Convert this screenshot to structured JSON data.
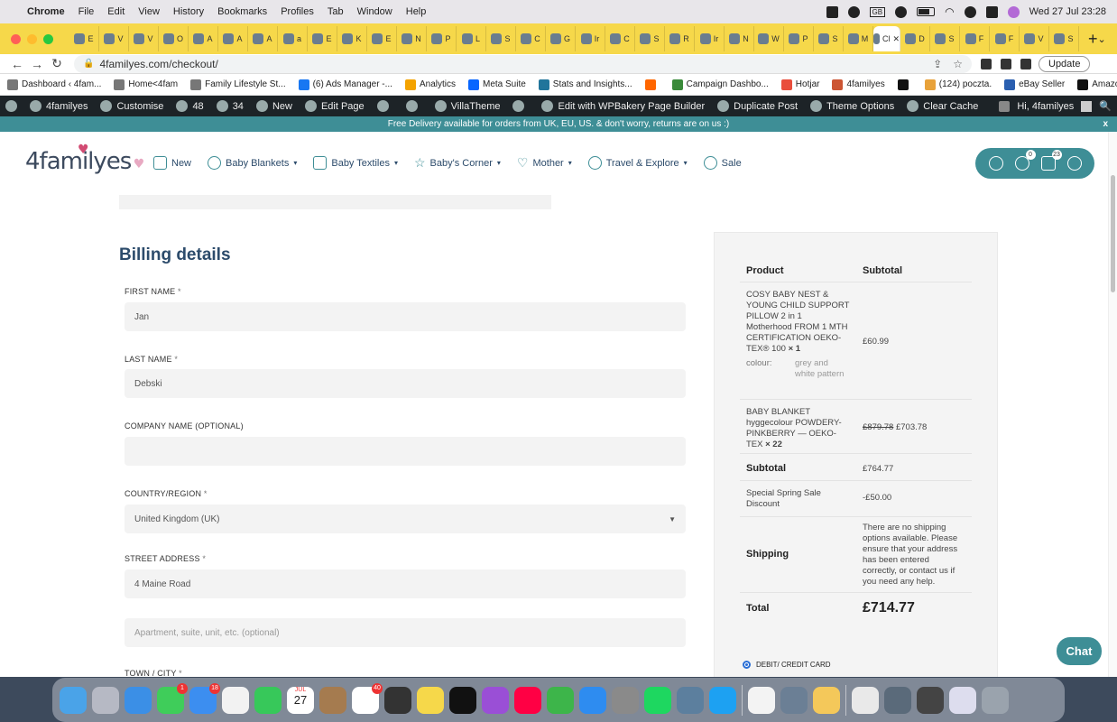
{
  "menubar": {
    "app": "Chrome",
    "items": [
      "File",
      "Edit",
      "View",
      "History",
      "Bookmarks",
      "Profiles",
      "Tab",
      "Window",
      "Help"
    ],
    "gb_badge": "GB",
    "datetime": "Wed 27 Jul  23:28"
  },
  "tabs": {
    "labels": [
      "E",
      "V",
      "V",
      "O",
      "A",
      "A",
      "A",
      "a",
      "E",
      "K",
      "E",
      "N",
      "P",
      "L",
      "S",
      "C",
      "G",
      "Ir",
      "C",
      "S",
      "R",
      "Ir",
      "N",
      "W",
      "P",
      "S",
      "M",
      "Cl",
      "D",
      "S",
      "F",
      "F",
      "V",
      "S"
    ],
    "active_index": 27,
    "new_tab": "+",
    "chevron": "⌄"
  },
  "url": {
    "text": "4familyes.com/checkout/",
    "update": "Update"
  },
  "bookmarks": [
    "Dashboard ‹ 4fam...",
    "Home<4fam",
    "Family Lifestyle St...",
    "(6) Ads Manager -...",
    "Analytics",
    "Meta Suite",
    "Stats and Insights...",
    "",
    "Campaign Dashbo...",
    "Hotjar",
    "4familyes",
    "",
    "(124) poczta.",
    "eBay Seller",
    "Amazon"
  ],
  "bookmarks_more": "»",
  "adminbar": {
    "items": [
      "4familyes",
      "Customise",
      "48",
      "34",
      "New",
      "Edit Page",
      "",
      "",
      "VillaTheme",
      "",
      "Edit with WPBakery Page Builder",
      "Duplicate Post",
      "Theme Options",
      "Clear Cache"
    ],
    "greeting": "Hi, 4familyes"
  },
  "banner": {
    "text": "Free Delivery available for orders from UK, EU, US. & don't worry, returns are on us :)",
    "close": "x"
  },
  "site": {
    "logo": "4familyes",
    "menu": [
      "New",
      "Baby Blankets",
      "Baby Textiles",
      "Baby's Corner",
      "Mother",
      "Travel & Explore",
      "Sale"
    ],
    "wishlist_count": "0",
    "cart_count": "23"
  },
  "billing": {
    "title": "Billing details",
    "first_name": {
      "label": "FIRST NAME",
      "value": "Jan"
    },
    "last_name": {
      "label": "LAST NAME",
      "value": "Debski"
    },
    "company": {
      "label": "COMPANY NAME (OPTIONAL)",
      "value": ""
    },
    "country": {
      "label": "COUNTRY/REGION",
      "value": "United Kingdom (UK)"
    },
    "street": {
      "label": "STREET ADDRESS",
      "value": "4 Maine Road",
      "placeholder2": "Apartment, suite, unit, etc. (optional)"
    },
    "town": {
      "label": "TOWN / CITY"
    },
    "required_mark": "*"
  },
  "order": {
    "col_product": "Product",
    "col_subtotal": "Subtotal",
    "item1": {
      "name": "COSY BABY NEST & YOUNG CHILD SUPPORT PILLOW 2 in 1 Motherhood FROM 1 MTH CERTIFICATION OEKO-TEX® 100",
      "qty": "× 1",
      "price": "£60.99",
      "attr_label": "colour:",
      "attr_value": "grey and white pattern"
    },
    "item2": {
      "name": "BABY BLANKET hyggecolour POWDERY-PINKBERRY — OEKO-TEX",
      "qty": "× 22",
      "old_price": "£879.78",
      "price": "£703.78"
    },
    "subtotal_label": "Subtotal",
    "subtotal": "£764.77",
    "discount_label": "Special Spring Sale Discount",
    "discount": "-£50.00",
    "shipping_label": "Shipping",
    "shipping_text": "There are no shipping options available. Please ensure that your address has been entered correctly, or contact us if you need any help.",
    "total_label": "Total",
    "total": "£714.77",
    "payment_label": "DEBIT/ CREDIT CARD"
  },
  "chat": "Chat",
  "dock": {
    "badges": {
      "messages": "1",
      "mail": "18",
      "reminders": "40"
    },
    "calendar_month": "JUL",
    "calendar_day": "27"
  }
}
